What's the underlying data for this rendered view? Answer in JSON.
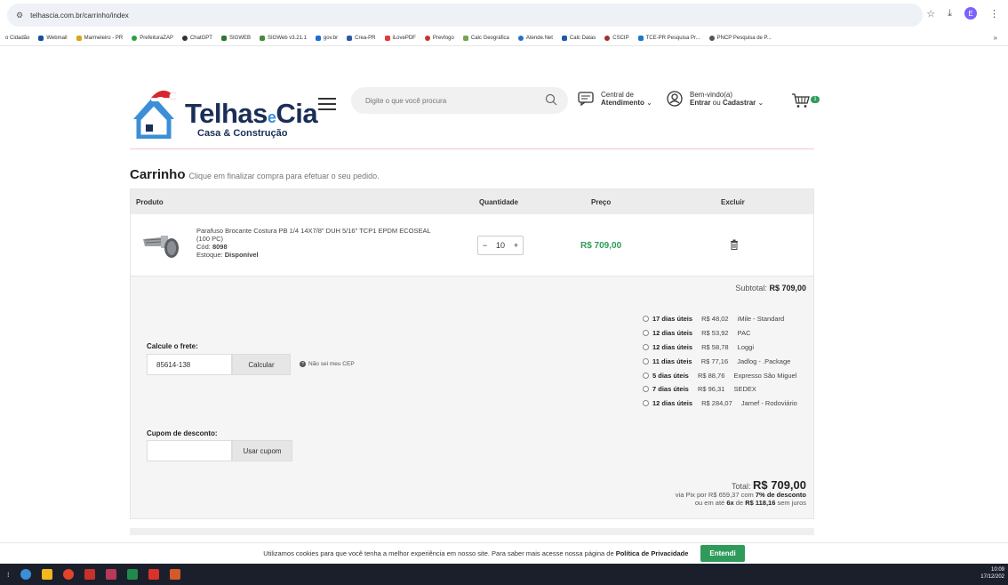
{
  "browser": {
    "url": "telhascia.com.br/carrinho/index",
    "profile_initial": "E",
    "bookmarks": [
      "o Cidadão",
      "Webmail",
      "Marmeleiro - PR",
      "PrefeituraZAP",
      "ChatGPT",
      "SIGWEB",
      "SIGWeb v3.21.1",
      "gov.br",
      "Crea-PR",
      "iLovePDF",
      "Prevfogo",
      "Calc Geográfica",
      "Atende.Net",
      "Calc Datas",
      "CSCIP",
      "TCE-PR Pesquisa Pr...",
      "PNCP Pesquisa de P..."
    ],
    "bookmark_more": "»"
  },
  "header": {
    "brand_left": "Telhas",
    "brand_e": "e",
    "brand_right": "Cia",
    "tagline": "Casa & Construção",
    "search_placeholder": "Digite o que você procura",
    "central_line1": "Central de",
    "central_line2": "Atendimento",
    "welcome_line1": "Bem-vindo(a)",
    "welcome_entrar": "Entrar",
    "welcome_ou": "ou",
    "welcome_cadastrar": "Cadastrar",
    "cart_count": "1"
  },
  "cart": {
    "title": "Carrinho",
    "subtitle": "Clique em finalizar compra para efetuar o seu pedido.",
    "columns": {
      "produto": "Produto",
      "quantidade": "Quantidade",
      "preco": "Preço",
      "excluir": "Excluir"
    },
    "item": {
      "name": "Parafuso Brocante Costura PB 1/4 14X7/8\" DUH 5/16\" TCP1 EPDM ECOSEAL (100 PC)",
      "cod_label": "Cód:",
      "cod": "8098",
      "stock_label": "Estoque:",
      "stock": "Disponível",
      "qty_minus": "−",
      "qty": "10",
      "qty_plus": "+",
      "price": "R$ 709,00"
    },
    "subtotal_label": "Subtotal:",
    "subtotal": "R$ 709,00",
    "shipping_options": [
      {
        "days": "17 dias úteis",
        "price": "R$ 48,02",
        "carrier": "iMile - Standard"
      },
      {
        "days": "12 dias úteis",
        "price": "R$ 53,92",
        "carrier": "PAC"
      },
      {
        "days": "12 dias úteis",
        "price": "R$ 58,78",
        "carrier": "Loggi"
      },
      {
        "days": "11 dias úteis",
        "price": "R$ 77,16",
        "carrier": "Jadlog - .Package"
      },
      {
        "days": "5 dias úteis",
        "price": "R$ 88,76",
        "carrier": "Expresso São Miguel"
      },
      {
        "days": "7 dias úteis",
        "price": "R$ 96,31",
        "carrier": "SEDEX"
      },
      {
        "days": "12 dias úteis",
        "price": "R$ 284,07",
        "carrier": "Jamef - Rodoviário"
      }
    ],
    "frete_label": "Calcule o frete:",
    "cep_value": "85614-138",
    "calc_button": "Calcular",
    "nosei": "Não sei meu CEP",
    "cupom_label": "Cupom de desconto:",
    "cupom_button": "Usar cupom",
    "total_label": "Total:",
    "total": "R$ 709,00",
    "pix_prefix": "via Pix por",
    "pix_value": "R$ 659,37",
    "pix_com": "com",
    "pix_discount": "7% de desconto",
    "installment_prefix": "ou em até",
    "installments": "6x",
    "installment_de": "de",
    "installment_value": "R$ 118,16",
    "installment_suffix": "sem juros"
  },
  "cookie": {
    "text": "Utilizamos cookies para que você tenha a melhor experiência em nosso site. Para saber mais acesse nossa página de",
    "policy": "Política de Privacidade",
    "button": "Entendi"
  },
  "taskbar": {
    "time": "10:09",
    "date": "17/12/202"
  },
  "colors": {
    "accent_green": "#2e9b5a",
    "brand_navy": "#1a2e57",
    "brand_blue": "#3a8fd6"
  }
}
